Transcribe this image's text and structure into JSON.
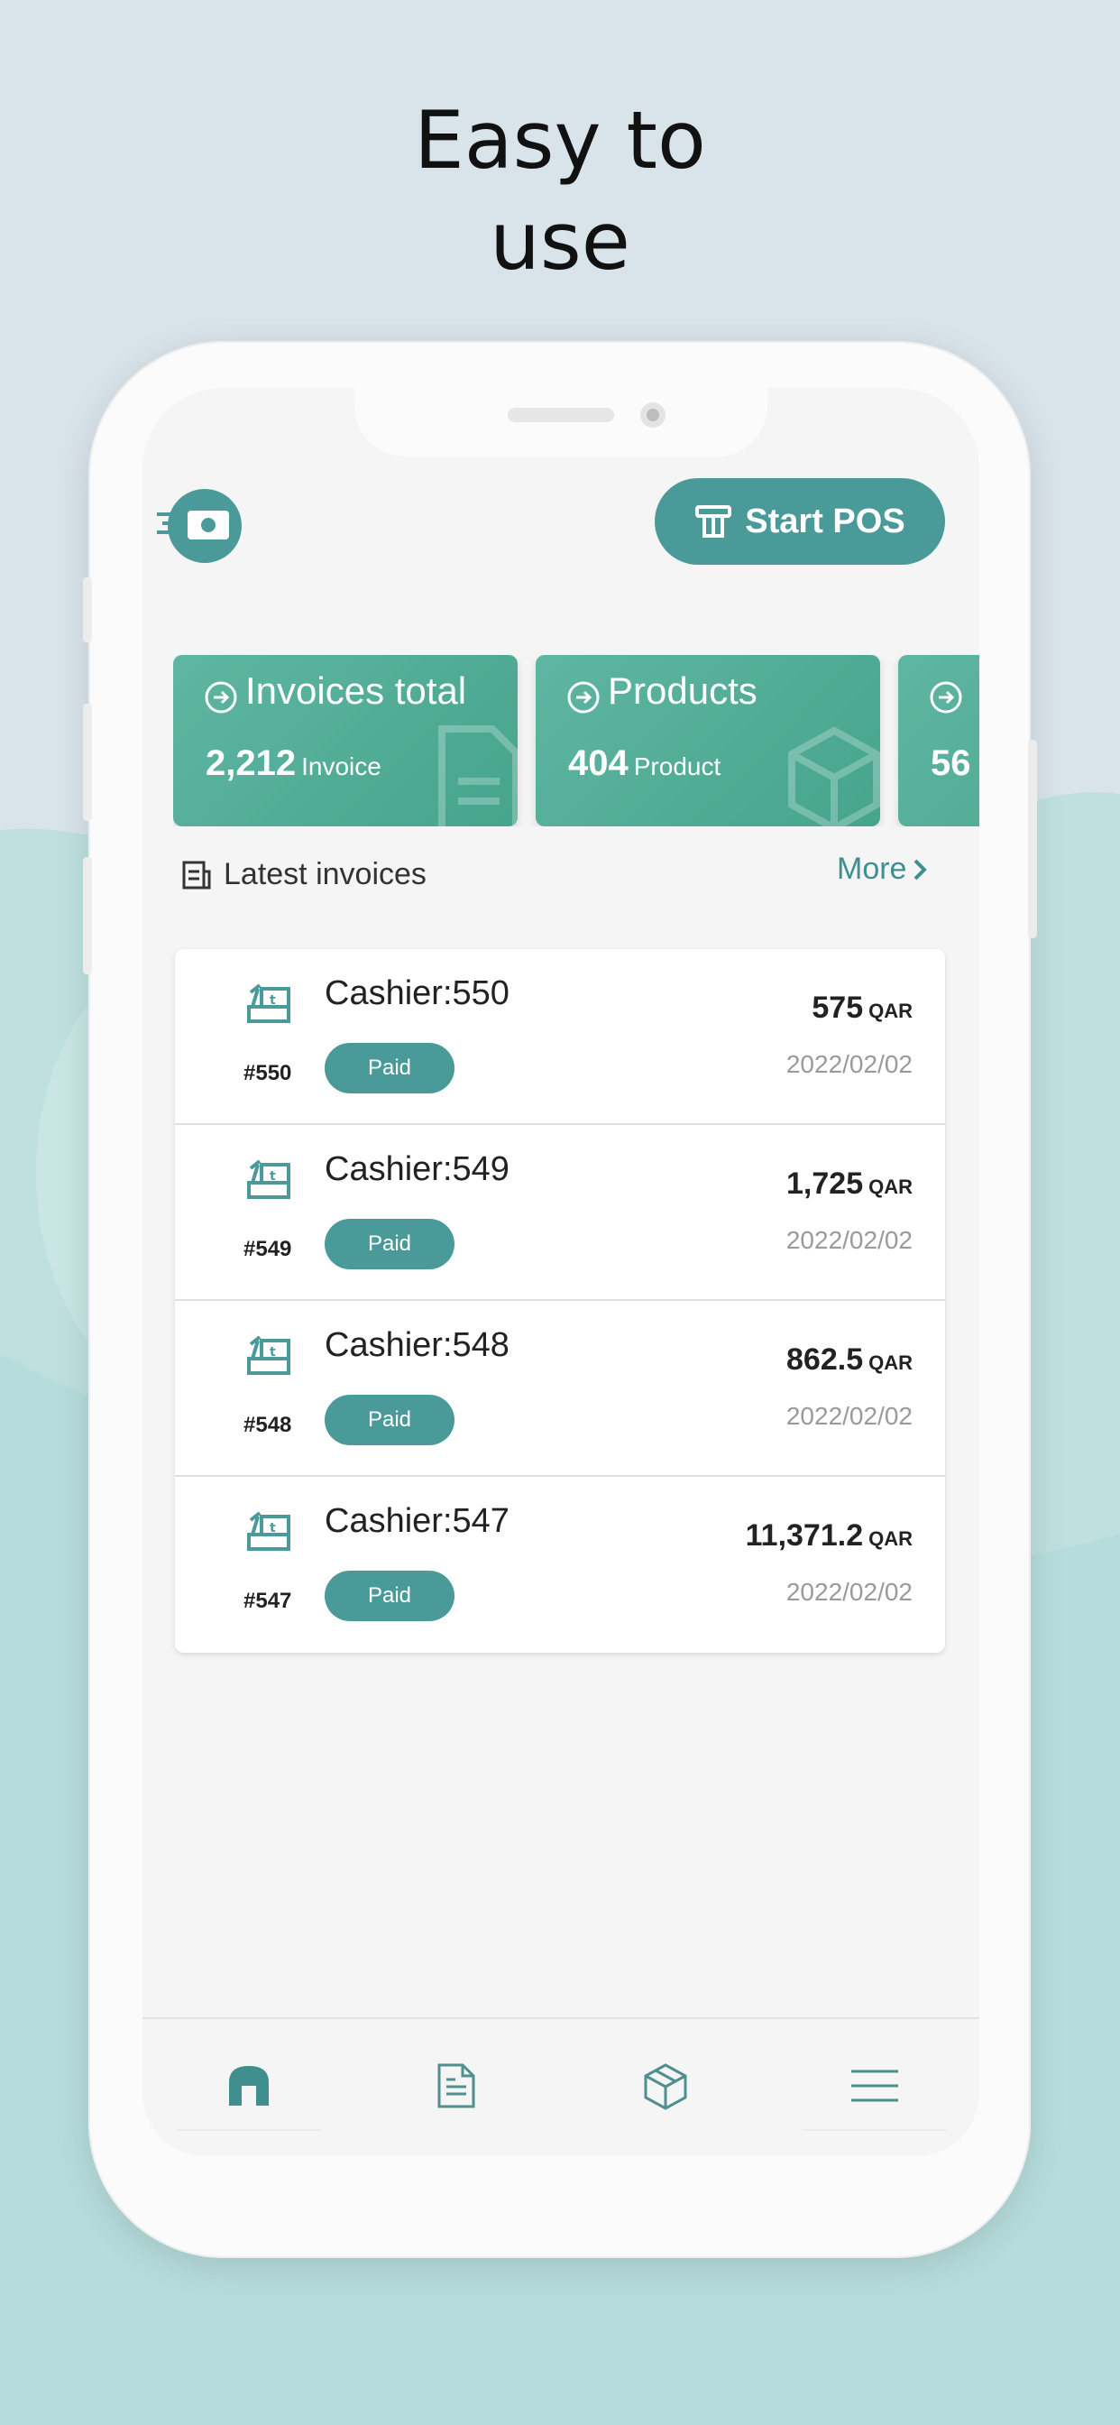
{
  "headline": {
    "line1": "Easy to",
    "line2": "use"
  },
  "colors": {
    "accent": "#4b9a9a",
    "card_green": "#52ad96",
    "muted": "#9a9a9a"
  },
  "header": {
    "logo_icon": "fast-money-icon",
    "start_pos_label": "Start POS",
    "start_pos_icon": "pos-terminal-icon"
  },
  "stat_cards": [
    {
      "title": "Invoices total",
      "value": "2,212",
      "unit": "Invoice",
      "icon": "document-icon"
    },
    {
      "title": "Products",
      "value": "404",
      "unit": "Product",
      "icon": "box-icon"
    },
    {
      "title": "",
      "value": "56",
      "unit": "",
      "icon": "arrow-circle-icon"
    }
  ],
  "latest": {
    "title": "Latest invoices",
    "more_label": "More"
  },
  "invoices": [
    {
      "cashier": "Cashier:550",
      "number": "#550",
      "status": "Paid",
      "amount": "575",
      "currency": "QAR",
      "date": "2022/02/02"
    },
    {
      "cashier": "Cashier:549",
      "number": "#549",
      "status": "Paid",
      "amount": "1,725",
      "currency": "QAR",
      "date": "2022/02/02"
    },
    {
      "cashier": "Cashier:548",
      "number": "#548",
      "status": "Paid",
      "amount": "862.5",
      "currency": "QAR",
      "date": "2022/02/02"
    },
    {
      "cashier": "Cashier:547",
      "number": "#547",
      "status": "Paid",
      "amount": "11,371.2",
      "currency": "QAR",
      "date": "2022/02/02"
    }
  ],
  "bottom_nav": [
    {
      "icon": "home-icon",
      "active": true
    },
    {
      "icon": "invoice-icon",
      "active": false
    },
    {
      "icon": "box-icon",
      "active": false
    },
    {
      "icon": "menu-icon",
      "active": false
    }
  ]
}
